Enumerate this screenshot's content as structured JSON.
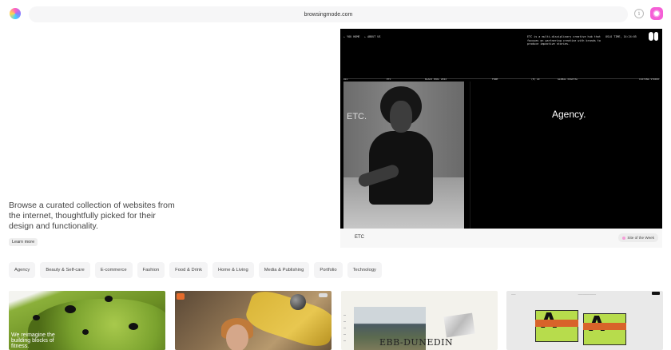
{
  "browser": {
    "url": "browsingmode.com",
    "icons": [
      "logo-icon",
      "info-icon",
      "pink-menu-icon"
    ]
  },
  "intro": {
    "text": "Browse a curated collection of websites from the internet, thoughtfully picked for their design and functionality.",
    "learn_more": "Learn more"
  },
  "hero": {
    "top_left_1": "← YOU HOME",
    "top_left_2": "← ABOUT US",
    "description": "ETC is a multi-disciplinary creative hub that focuses on partnering creative with brands to produce impactive stories.",
    "timezone": "OSLO TIME, 14:24:05",
    "labels": [
      "ALL",
      "ETC",
      "BLACK POOL 2022",
      "FORM",
      "(E) AI",
      "GLOBAL DIGITAL",
      "CASTING STUDIO"
    ],
    "photo_text": "ETC.",
    "agency_text": "Agency.",
    "site_name": "ETC",
    "badge": "Site of the Week"
  },
  "categories": [
    "Agency",
    "Beauty & Self-care",
    "E-commerce",
    "Fashion",
    "Food & Drink",
    "Home & Living",
    "Media & Publishing",
    "Portfolio",
    "Technology"
  ],
  "cards": [
    {
      "text": "We reimagine the building blocks of fitness."
    },
    {
      "text": ""
    },
    {
      "text": "EBB-DUNEDIN"
    },
    {
      "text": ""
    }
  ],
  "colors": {
    "accent": "#f55fd6",
    "chip_bg": "#f4f4f5",
    "hero_bg": "#000000"
  }
}
